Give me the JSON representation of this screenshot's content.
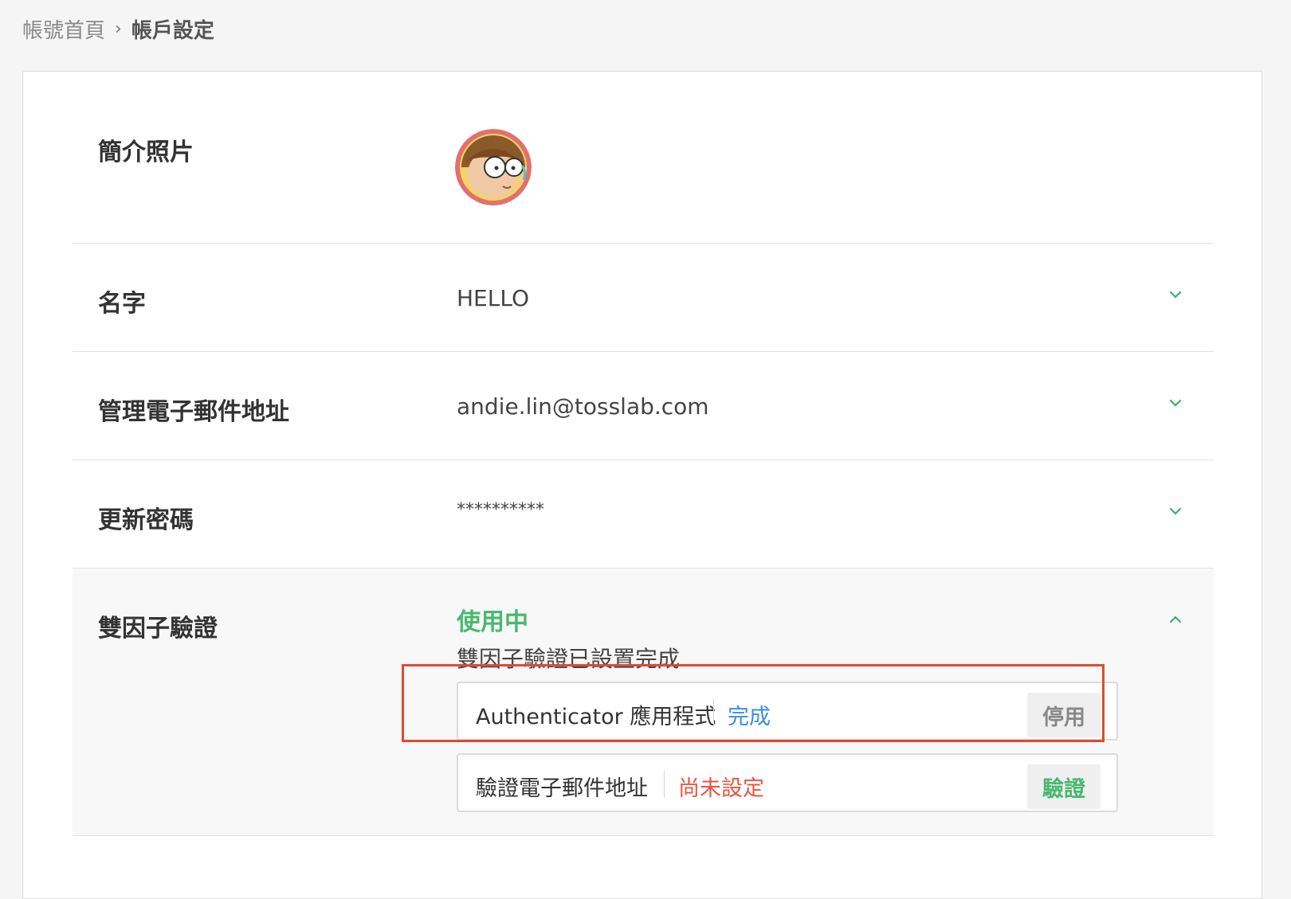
{
  "breadcrumb": {
    "home": "帳號首頁",
    "separator": "›",
    "current": "帳戶設定"
  },
  "profile_photo": {
    "label": "簡介照片"
  },
  "name": {
    "label": "名字",
    "value": "HELLO"
  },
  "email": {
    "label": "管理電子郵件地址",
    "value": "andie.lin@tosslab.com"
  },
  "password": {
    "label": "更新密碼",
    "value": "**********"
  },
  "two_factor": {
    "label": "雙因子驗證",
    "status": "使用中",
    "description": "雙因子驗證已設置完成",
    "methods": [
      {
        "name": "Authenticator 應用程式",
        "state": "完成",
        "state_color": "#3a8ee6",
        "button": "停用",
        "button_color": "#888888"
      },
      {
        "name": "驗證電子郵件地址",
        "state": "尚未設定",
        "state_color": "#e8543e",
        "button": "驗證",
        "button_color": "#47b96e"
      }
    ]
  },
  "colors": {
    "accent_green": "#47b96e",
    "highlight_red": "#e04a2f"
  }
}
